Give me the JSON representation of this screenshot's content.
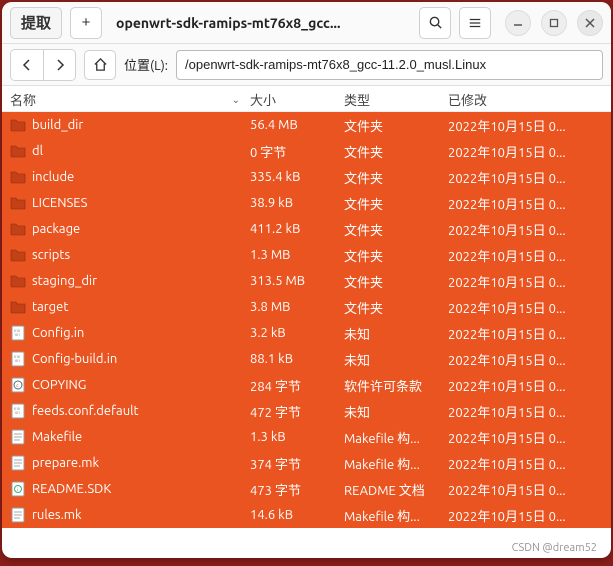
{
  "titlebar": {
    "extract_label": "提取",
    "new_label": "+",
    "title": "openwrt-sdk-ramips-mt76x8_gcc...",
    "search_icon": "search",
    "menu_icon": "hamburger"
  },
  "pathbar": {
    "location_label": "位置(L):",
    "path_value": "/openwrt-sdk-ramips-mt76x8_gcc-11.2.0_musl.Linux"
  },
  "columns": {
    "name": "名称",
    "size": "大小",
    "type": "类型",
    "modified": "已修改"
  },
  "files": [
    {
      "icon": "folder",
      "name": "build_dir",
      "size": "56.4 MB",
      "type": "文件夹",
      "modified": "2022年10月15日 0..."
    },
    {
      "icon": "folder",
      "name": "dl",
      "size": "0 字节",
      "type": "文件夹",
      "modified": "2022年10月15日 0..."
    },
    {
      "icon": "folder",
      "name": "include",
      "size": "335.4 kB",
      "type": "文件夹",
      "modified": "2022年10月15日 0..."
    },
    {
      "icon": "folder",
      "name": "LICENSES",
      "size": "38.9 kB",
      "type": "文件夹",
      "modified": "2022年10月15日 0..."
    },
    {
      "icon": "folder",
      "name": "package",
      "size": "411.2 kB",
      "type": "文件夹",
      "modified": "2022年10月15日 0..."
    },
    {
      "icon": "folder",
      "name": "scripts",
      "size": "1.3 MB",
      "type": "文件夹",
      "modified": "2022年10月15日 0..."
    },
    {
      "icon": "folder",
      "name": "staging_dir",
      "size": "313.5 MB",
      "type": "文件夹",
      "modified": "2022年10月15日 0..."
    },
    {
      "icon": "folder",
      "name": "target",
      "size": "3.8 MB",
      "type": "文件夹",
      "modified": "2022年10月15日 0..."
    },
    {
      "icon": "binary",
      "name": "Config.in",
      "size": "3.2 kB",
      "type": "未知",
      "modified": "2022年10月15日 0..."
    },
    {
      "icon": "binary",
      "name": "Config-build.in",
      "size": "88.1 kB",
      "type": "未知",
      "modified": "2022年10月15日 0..."
    },
    {
      "icon": "copyright",
      "name": "COPYING",
      "size": "284 字节",
      "type": "软件许可条款",
      "modified": "2022年10月15日 0..."
    },
    {
      "icon": "binary",
      "name": "feeds.conf.default",
      "size": "472 字节",
      "type": "未知",
      "modified": "2022年10月15日 0..."
    },
    {
      "icon": "text",
      "name": "Makefile",
      "size": "1.3 kB",
      "type": "Makefile 构...",
      "modified": "2022年10月15日 0..."
    },
    {
      "icon": "text",
      "name": "prepare.mk",
      "size": "374 字节",
      "type": "Makefile 构...",
      "modified": "2022年10月15日 0..."
    },
    {
      "icon": "readme",
      "name": "README.SDK",
      "size": "473 字节",
      "type": "README 文档",
      "modified": "2022年10月15日 0..."
    },
    {
      "icon": "text",
      "name": "rules.mk",
      "size": "14.6 kB",
      "type": "Makefile 构...",
      "modified": "2022年10月15日 0..."
    }
  ],
  "watermark": "CSDN @dream52"
}
